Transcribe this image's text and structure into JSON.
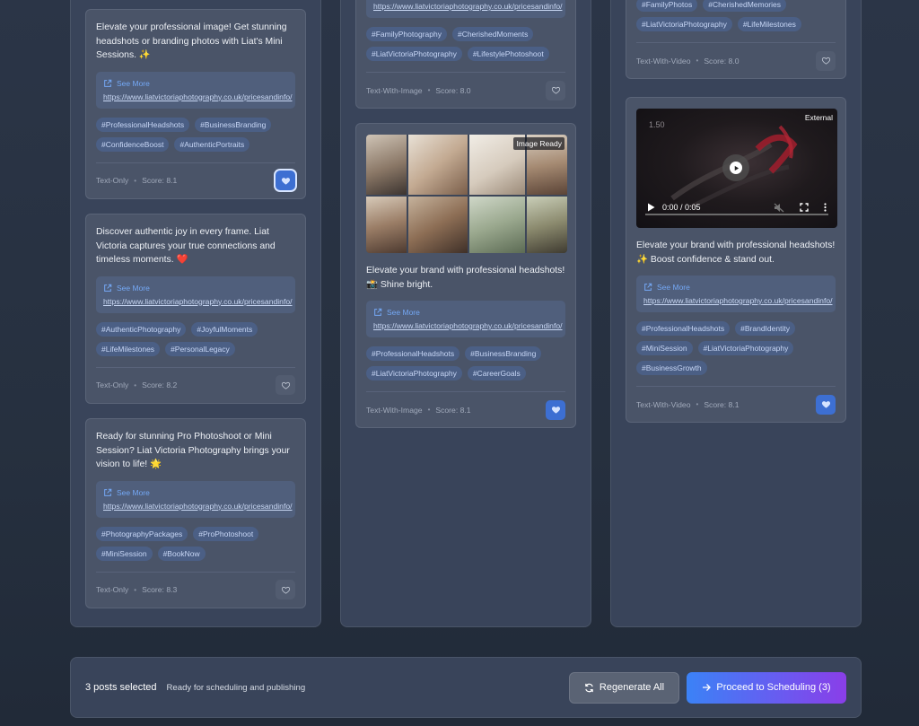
{
  "columns": [
    {
      "cards": [
        {
          "text": "Elevate your professional image! Get stunning headshots or branding photos with Liat's Mini Sessions. ✨",
          "see_more": "See More",
          "url": "https://www.liatvictoriaphotography.co.uk/pricesandinfo/",
          "tags": [
            "#ProfessionalHeadshots",
            "#BusinessBranding",
            "#ConfidenceBoost",
            "#AuthenticPortraits"
          ],
          "type": "Text-Only",
          "score": "Score: 8.1",
          "selected": true
        },
        {
          "text": "Discover authentic joy in every frame. Liat Victoria captures your true connections and timeless moments. ❤️",
          "see_more": "See More",
          "url": "https://www.liatvictoriaphotography.co.uk/pricesandinfo/",
          "tags": [
            "#AuthenticPhotography",
            "#JoyfulMoments",
            "#LifeMilestones",
            "#PersonalLegacy"
          ],
          "type": "Text-Only",
          "score": "Score: 8.2",
          "selected": false
        },
        {
          "text": "Ready for stunning Pro Photoshoot or Mini Session? Liat Victoria Photography brings your vision to life! 🌟",
          "see_more": "See More",
          "url": "https://www.liatvictoriaphotography.co.uk/pricesandinfo/",
          "tags": [
            "#PhotographyPackages",
            "#ProPhotoshoot",
            "#MiniSession",
            "#BookNow"
          ],
          "type": "Text-Only",
          "score": "Score: 8.3",
          "selected": false
        }
      ]
    },
    {
      "cards": [
        {
          "url": "https://www.liatvictoriaphotography.co.uk/pricesandinfo/",
          "tags": [
            "#FamilyPhotography",
            "#CherishedMoments",
            "#LiatVictoriaPhotography",
            "#LifestylePhotoshoot"
          ],
          "type": "Text-With-Image",
          "score": "Score: 8.0",
          "selected": false
        },
        {
          "image_badge": "Image Ready",
          "text": "Elevate your brand with professional headshots! 📸 Shine bright.",
          "see_more": "See More",
          "url": "https://www.liatvictoriaphotography.co.uk/pricesandinfo/",
          "tags": [
            "#ProfessionalHeadshots",
            "#BusinessBranding",
            "#LiatVictoriaPhotography",
            "#CareerGoals"
          ],
          "type": "Text-With-Image",
          "score": "Score: 8.1",
          "selected": true
        }
      ]
    },
    {
      "cards": [
        {
          "tags": [
            "#FamilyPhotos",
            "#CherishedMemories",
            "#LiatVictoriaPhotography",
            "#LifeMilestones"
          ],
          "type": "Text-With-Video",
          "score": "Score: 8.0",
          "selected": false
        },
        {
          "video_badge": "External",
          "video_label": "1.50",
          "video_time": "0:00 / 0:05",
          "text": "Elevate your brand with professional headshots! ✨ Boost confidence & stand out.",
          "see_more": "See More",
          "url": "https://www.liatvictoriaphotography.co.uk/pricesandinfo/",
          "tags": [
            "#ProfessionalHeadshots",
            "#BrandIdentity",
            "#MiniSession",
            "#LiatVictoriaPhotography",
            "#BusinessGrowth"
          ],
          "type": "Text-With-Video",
          "score": "Score: 8.1",
          "selected": true
        }
      ]
    }
  ],
  "bottom_bar": {
    "count": "3 posts selected",
    "status": "Ready for scheduling and publishing",
    "regenerate_label": "Regenerate All",
    "proceed_label": "Proceed to Scheduling (3)"
  },
  "colors": {
    "accent": "#3b82f6",
    "accent_purple": "#8a3ee8",
    "tag_bg": "#4b5f85",
    "link": "#74a8f5"
  }
}
